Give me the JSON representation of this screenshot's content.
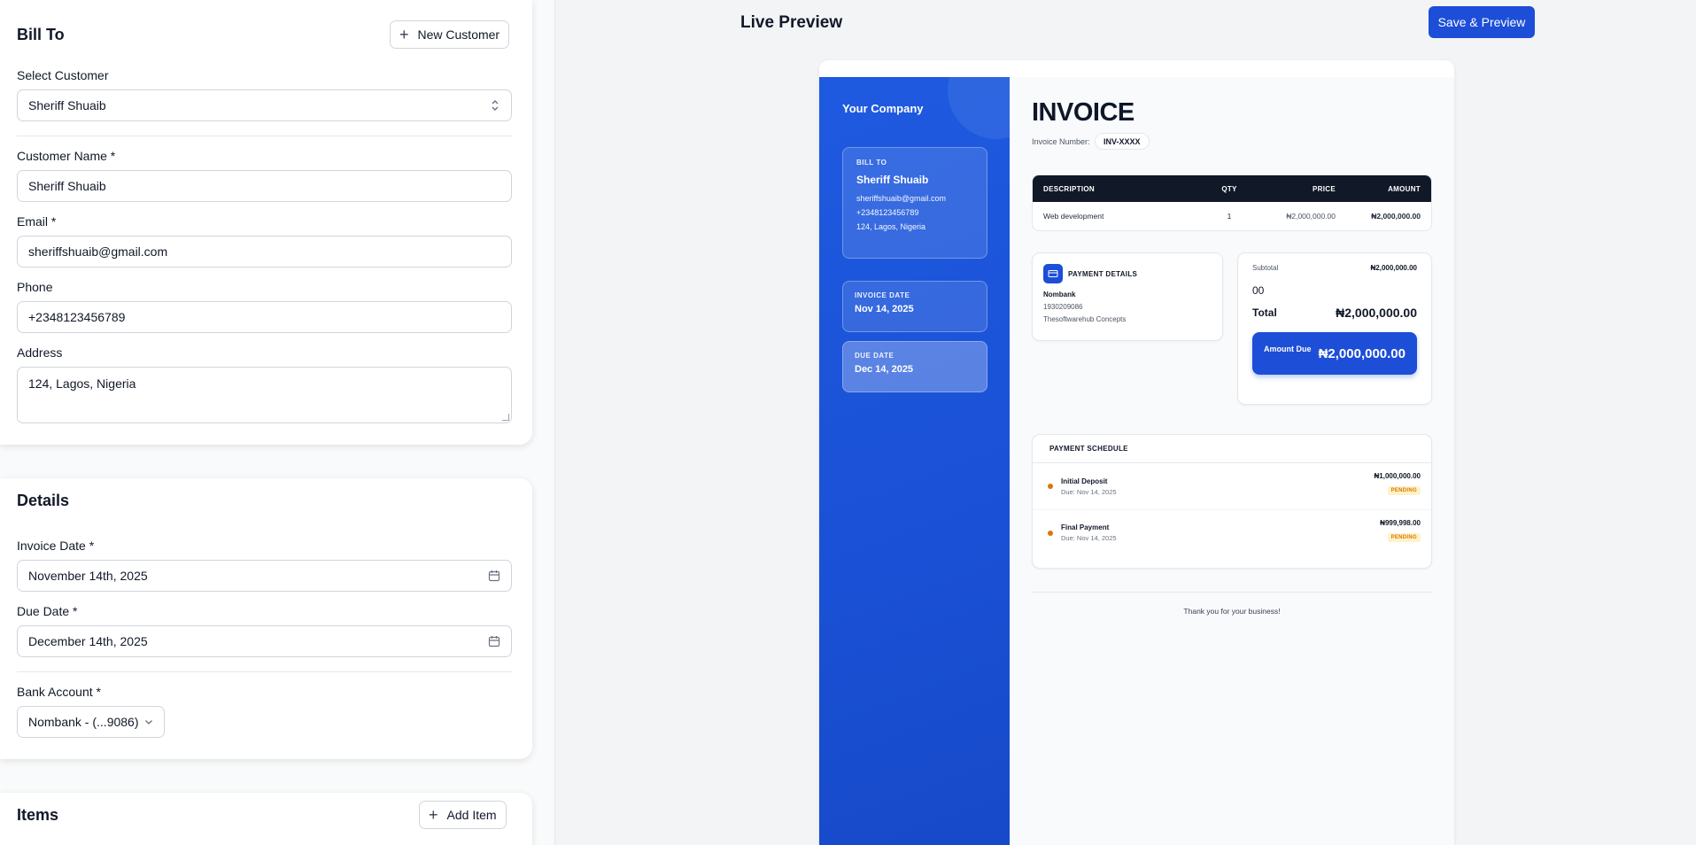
{
  "form": {
    "bill_to": {
      "title": "Bill To",
      "new_customer_label": "New Customer",
      "select_customer_label": "Select Customer",
      "select_customer_value": "Sheriff Shuaib",
      "customer_name_label": "Customer Name *",
      "customer_name_value": "Sheriff Shuaib",
      "email_label": "Email *",
      "email_value": "sheriffshuaib@gmail.com",
      "phone_label": "Phone",
      "phone_value": "+2348123456789",
      "address_label": "Address",
      "address_value": "124, Lagos, Nigeria"
    },
    "details": {
      "title": "Details",
      "invoice_date_label": "Invoice Date *",
      "invoice_date_value": "November 14th, 2025",
      "due_date_label": "Due Date *",
      "due_date_value": "December 14th, 2025",
      "bank_account_label": "Bank Account *",
      "bank_account_value": "Nombank - (...9086)"
    },
    "items": {
      "title": "Items",
      "add_item_label": "Add Item"
    }
  },
  "preview": {
    "title": "Live Preview",
    "save_label": "Save & Preview"
  },
  "invoice": {
    "company": "Your Company",
    "bill_to_caption": "BILL TO",
    "bill_name": "Sheriff Shuaib",
    "bill_email": "sheriffshuaib@gmail.com",
    "bill_phone": "+2348123456789",
    "bill_address": "124, Lagos, Nigeria",
    "invoice_date_caption": "INVOICE DATE",
    "invoice_date": "Nov 14, 2025",
    "due_date_caption": "DUE DATE",
    "due_date": "Dec 14, 2025",
    "heading": "INVOICE",
    "number_label": "Invoice Number:",
    "number": "INV-XXXX",
    "table": {
      "headers": [
        "DESCRIPTION",
        "QTY",
        "PRICE",
        "AMOUNT"
      ],
      "rows": [
        {
          "description": "Web development",
          "qty": "1",
          "price": "₦2,000,000.00",
          "amount": "₦2,000,000.00"
        }
      ]
    },
    "payment": {
      "caption": "PAYMENT DETAILS",
      "bank": "Nombank",
      "account": "1930209086",
      "account_name": "Thesoftwarehub Concepts"
    },
    "summary": {
      "subtotal_label": "Subtotal",
      "subtotal_value": "₦2,000,000.00",
      "tax_text": "00",
      "total_label": "Total",
      "total_value": "₦2,000,000.00",
      "amount_due_label": "Amount Due",
      "amount_due_value": "₦2,000,000.00"
    },
    "schedule": {
      "caption": "PAYMENT SCHEDULE",
      "entries": [
        {
          "name": "Initial Deposit",
          "due": "Due: Nov 14, 2025",
          "amount": "₦1,000,000.00",
          "status": "PENDING"
        },
        {
          "name": "Final Payment",
          "due": "Due: Nov 14, 2025",
          "amount": "₦999,998.00",
          "status": "PENDING"
        }
      ]
    },
    "thanks": "Thank you for your business!"
  },
  "colors": {
    "accent": "#1d4ed8",
    "table_header": "#111827",
    "pending": "#d97706"
  }
}
